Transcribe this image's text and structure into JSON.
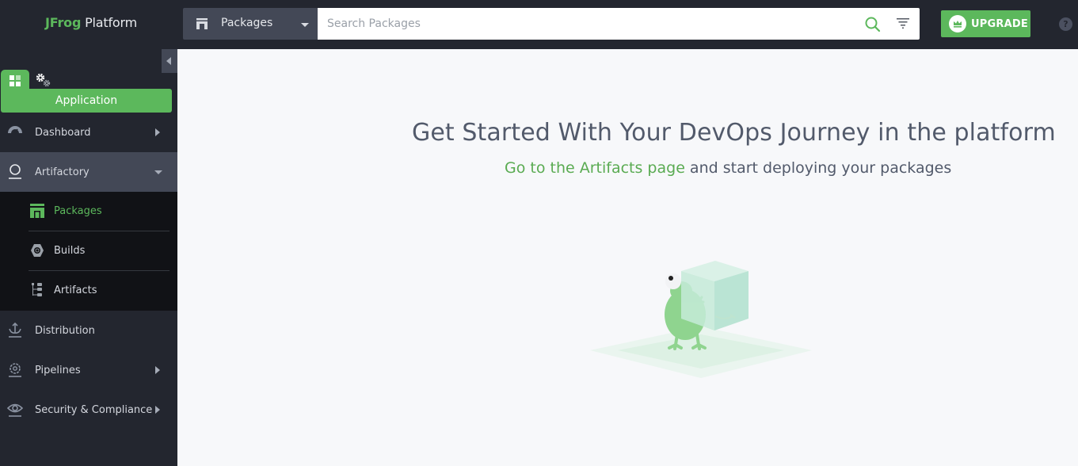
{
  "header": {
    "logo_brand": "JFrog",
    "logo_product": "Platform",
    "search_scope": "Packages",
    "search_placeholder": "Search Packages",
    "search_value": "",
    "upgrade_label": "UPGRADE",
    "help_label": "?",
    "icons": {
      "scope": "packages-icon",
      "search": "search-icon",
      "filter": "filter-icon",
      "upgrade": "crown-icon",
      "help": "help-icon"
    }
  },
  "sidebar": {
    "mode_tabs": [
      {
        "name": "application",
        "icon": "grid-icon",
        "active": true
      },
      {
        "name": "administration",
        "icon": "gears-icon",
        "active": false
      }
    ],
    "mode_label": "Application",
    "items": [
      {
        "label": "Dashboard",
        "icon": "gauge-icon",
        "expandable": true,
        "expanded": false
      },
      {
        "label": "Artifactory",
        "icon": "artifactory-icon",
        "expandable": true,
        "expanded": true,
        "children": [
          {
            "label": "Packages",
            "icon": "packages-icon",
            "active": true
          },
          {
            "label": "Builds",
            "icon": "builds-icon",
            "active": false
          },
          {
            "label": "Artifacts",
            "icon": "tree-icon",
            "active": false
          }
        ]
      },
      {
        "label": "Distribution",
        "icon": "distribution-icon",
        "expandable": false
      },
      {
        "label": "Pipelines",
        "icon": "pipelines-icon",
        "expandable": true,
        "expanded": false
      },
      {
        "label": "Security & Compliance",
        "icon": "eye-icon",
        "expandable": true,
        "expanded": false
      }
    ]
  },
  "main": {
    "headline": "Get Started With Your DevOps Journey in the platform",
    "subline_link": "Go to the Artifacts page",
    "subline_rest": " and start deploying your packages",
    "illustration": "frog-holding-cube-illustration"
  },
  "colors": {
    "accent": "#5cb85c",
    "topbar_bg": "#23262f",
    "sidebar_bg": "#23262f",
    "subnav_bg": "#111216",
    "active_item_bg": "#434856",
    "main_bg": "#f7f8fa",
    "headline_text": "#525a6b"
  }
}
